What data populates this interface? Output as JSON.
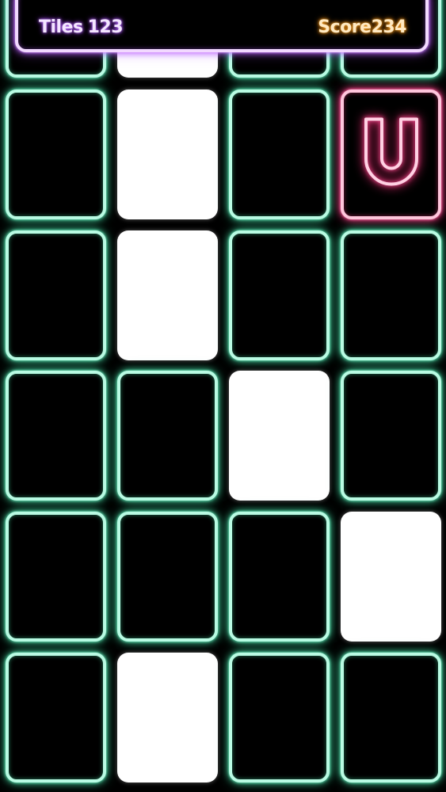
{
  "hud": {
    "tiles_label": "Tiles",
    "tiles_value": "123",
    "score_label": "Score",
    "score_value": "234"
  },
  "colors": {
    "tile_glow": "#3fcf9b",
    "tile_border": "#b9fbe3",
    "hud_glow": "#b65cff",
    "tiles_text": "#f4e6ff",
    "score_text": "#ffe9c2",
    "powerup_glow": "#ff3f88"
  },
  "board": {
    "columns": 4,
    "rows": [
      [
        "dark",
        "white",
        "dark",
        "dark"
      ],
      [
        "dark",
        "white",
        "dark",
        "powerup"
      ],
      [
        "dark",
        "white",
        "dark",
        "dark"
      ],
      [
        "dark",
        "dark",
        "white",
        "dark"
      ],
      [
        "dark",
        "dark",
        "dark",
        "white"
      ],
      [
        "dark",
        "white",
        "dark",
        "dark"
      ]
    ],
    "powerup_icon": "magnet-icon"
  }
}
